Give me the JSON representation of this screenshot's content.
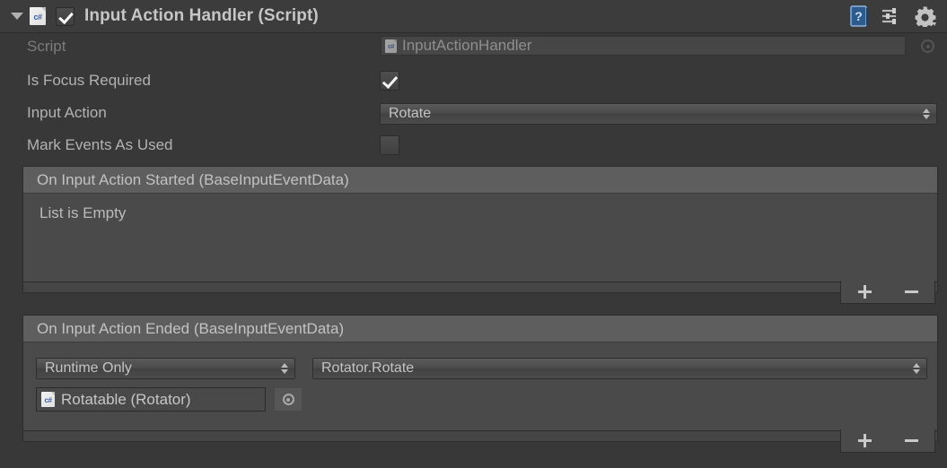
{
  "header": {
    "title": "Input Action Handler (Script)",
    "enabled_checkbox": true,
    "foldout_expanded": true,
    "script_icon": "csharp-script-icon",
    "icons": [
      {
        "name": "help-icon",
        "label": "?"
      },
      {
        "name": "preset-icon",
        "label": ""
      },
      {
        "name": "gear-icon",
        "label": ""
      }
    ]
  },
  "fields": {
    "script": {
      "label": "Script",
      "value": "InputActionHandler",
      "disabled": true,
      "icon": "csharp-script-icon",
      "picker_icon": "object-picker-icon"
    },
    "is_focus_required": {
      "label": "Is Focus Required",
      "checked": true
    },
    "input_action": {
      "label": "Input Action",
      "value": "Rotate"
    },
    "mark_events_as_used": {
      "label": "Mark Events As Used",
      "checked": false
    }
  },
  "events": [
    {
      "title": "On Input Action Started (BaseInputEventData)",
      "empty_text": "List is Empty",
      "entries": [],
      "add_label": "+",
      "remove_label": "−"
    },
    {
      "title": "On Input Action Ended (BaseInputEventData)",
      "empty_text": "",
      "entries": [
        {
          "call_state": "Runtime Only",
          "function": "Rotator.Rotate",
          "target_object": "Rotatable (Rotator)",
          "target_icon": "csharp-script-icon",
          "picker_icon": "object-picker-icon"
        }
      ],
      "add_label": "+",
      "remove_label": "−"
    }
  ],
  "colors": {
    "panel_bg": "#383838",
    "header_bg": "#3c3c3c",
    "event_body_bg": "#4a4a4a",
    "event_header_bg": "#5e5e5e",
    "text": "#b4b4b4",
    "text_dim": "#7c7c7c"
  }
}
